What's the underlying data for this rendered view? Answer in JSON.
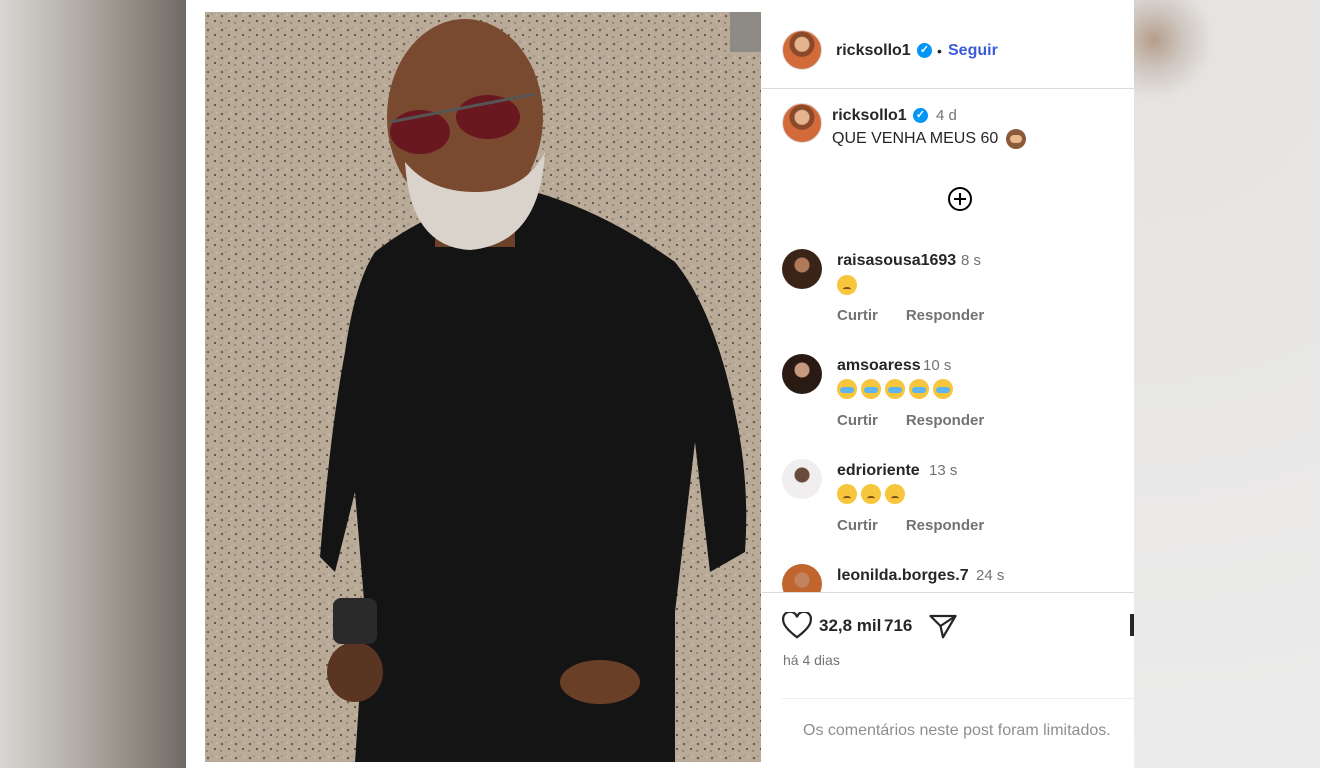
{
  "post": {
    "username": "ricksollo1",
    "verified_badge": "✓",
    "dot": "•",
    "follow_label": "Seguir",
    "caption_age": "4 d",
    "caption_text": "QUE VENHA MEUS 60",
    "caption_emoji": "see-no-evil-monkey-icon"
  },
  "comments": [
    {
      "username": "raisasousa1693",
      "time": "8 s",
      "emojis": [
        "sad"
      ],
      "like_label": "Curtir",
      "reply_label": "Responder"
    },
    {
      "username": "amsoaress",
      "time": "10 s",
      "emojis": [
        "cry",
        "cry",
        "cry",
        "cry",
        "cry"
      ],
      "like_label": "Curtir",
      "reply_label": "Responder"
    },
    {
      "username": "edrioriente",
      "time": "13 s",
      "emojis": [
        "sad",
        "sad",
        "sad"
      ],
      "like_label": "Curtir",
      "reply_label": "Responder"
    },
    {
      "username": "leonilda.borges.7",
      "time": "24 s"
    }
  ],
  "footer": {
    "likes_count": "32,8 mil",
    "comments_count": "716",
    "posted_ago": "há 4 dias",
    "comments_limited": "Os comentários neste post foram limitados."
  },
  "colors": {
    "follow": "#3b5bdb",
    "verified": "#0095f6",
    "muted": "#737373"
  }
}
